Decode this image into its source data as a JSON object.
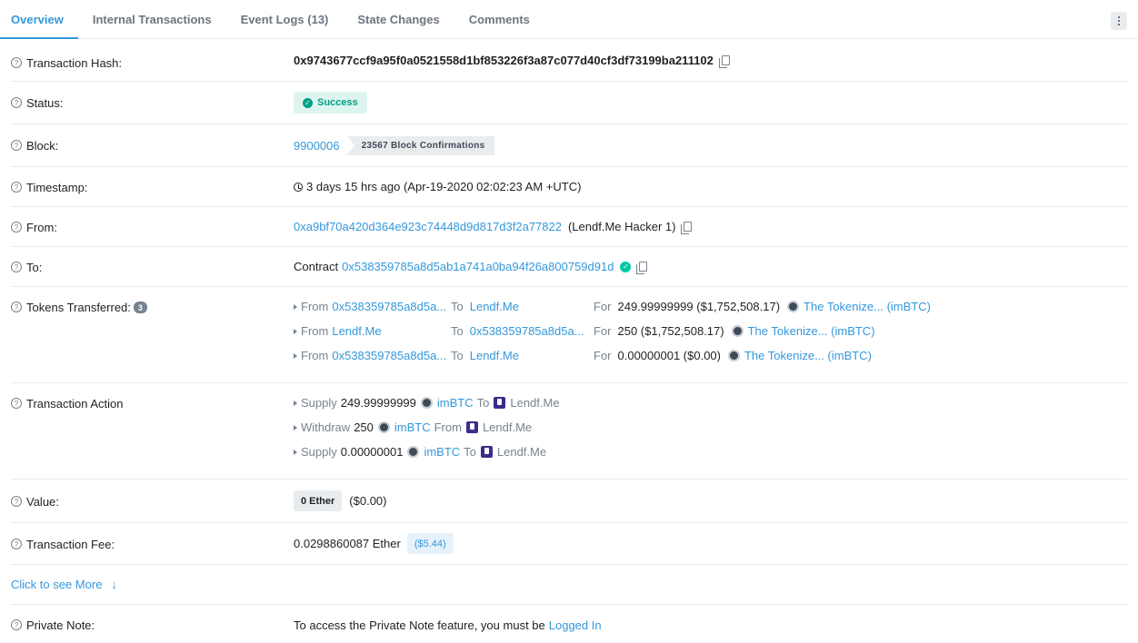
{
  "tabs": [
    "Overview",
    "Internal Transactions",
    "Event Logs (13)",
    "State Changes",
    "Comments"
  ],
  "rows": {
    "tx_hash": {
      "label": "Transaction Hash:",
      "value": "0x9743677ccf9a95f0a0521558d1bf853226f3a87c077d40cf3df73199ba211102"
    },
    "status": {
      "label": "Status:",
      "value": "Success"
    },
    "block": {
      "label": "Block:",
      "number": "9900006",
      "confirmations": "23567 Block Confirmations"
    },
    "timestamp": {
      "label": "Timestamp:",
      "value": "3 days 15 hrs ago (Apr-19-2020 02:02:23 AM +UTC)"
    },
    "from": {
      "label": "From:",
      "address": "0xa9bf70a420d364e923c74448d9d817d3f2a77822",
      "name": "(Lendf.Me Hacker 1)"
    },
    "to": {
      "label": "To:",
      "prefix": "Contract",
      "address": "0x538359785a8d5ab1a741a0ba94f26a800759d91d"
    },
    "tokens": {
      "label": "Tokens Transferred:",
      "count": "3",
      "items": [
        {
          "from_kw": "From",
          "from": "0x538359785a8d5a...",
          "to_kw": "To",
          "to": "Lendf.Me",
          "for_kw": "For",
          "amount": "249.99999999 ($1,752,508.17)",
          "token": "The Tokenize... (imBTC)"
        },
        {
          "from_kw": "From",
          "from": "Lendf.Me",
          "to_kw": "To",
          "to": "0x538359785a8d5a...",
          "for_kw": "For",
          "amount": "250 ($1,752,508.17)",
          "token": "The Tokenize... (imBTC)"
        },
        {
          "from_kw": "From",
          "from": "0x538359785a8d5a...",
          "to_kw": "To",
          "to": "Lendf.Me",
          "for_kw": "For",
          "amount": "0.00000001 ($0.00)",
          "token": "The Tokenize... (imBTC)"
        }
      ]
    },
    "action": {
      "label": "Transaction Action",
      "items": [
        {
          "verb": "Supply",
          "amount": "249.99999999",
          "token": "imBTC",
          "dir": "To",
          "target": "Lendf.Me"
        },
        {
          "verb": "Withdraw",
          "amount": "250",
          "token": "imBTC",
          "dir": "From",
          "target": "Lendf.Me"
        },
        {
          "verb": "Supply",
          "amount": "0.00000001",
          "token": "imBTC",
          "dir": "To",
          "target": "Lendf.Me"
        }
      ]
    },
    "value": {
      "label": "Value:",
      "ether": "0 Ether",
      "usd": "($0.00)"
    },
    "fee": {
      "label": "Transaction Fee:",
      "ether": "0.0298860087 Ether",
      "usd": "($5.44)"
    },
    "more": {
      "label": "Click to see More"
    },
    "private_note": {
      "label": "Private Note:",
      "text": "To access the Private Note feature, you must be",
      "link": "Logged In"
    }
  }
}
